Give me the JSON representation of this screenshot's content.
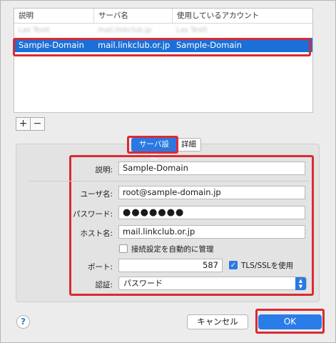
{
  "table": {
    "columns": [
      "説明",
      "サーバ名",
      "使用しているアカウント"
    ],
    "blurred_row": [
      "Las Testt",
      "mail.linkclub.jp",
      "Las Testt"
    ],
    "selected_row": [
      "Sample-Domain",
      "mail.linkclub.or.jp",
      "Sample-Domain"
    ]
  },
  "controls": {
    "add_label": "+",
    "remove_label": "−"
  },
  "tabs": {
    "server_settings": "サーバ設定",
    "details": "詳細"
  },
  "form": {
    "description_label": "説明:",
    "description_value": "Sample-Domain",
    "username_label": "ユーザ名:",
    "username_value": "root@sample-domain.jp",
    "password_label": "パスワード:",
    "password_value": "●●●●●●●",
    "host_label": "ホスト名:",
    "host_value": "mail.linkclub.or.jp",
    "auto_manage_label": "接続設定を自動的に管理",
    "port_label": "ポート:",
    "port_value": "587",
    "tls_label": "TLS/SSLを使用",
    "auth_label": "認証:",
    "auth_value": "パスワード"
  },
  "buttons": {
    "help": "?",
    "cancel": "キャンセル",
    "ok": "OK"
  },
  "highlight_color": "#d92b34",
  "accent_color": "#2a79e3"
}
